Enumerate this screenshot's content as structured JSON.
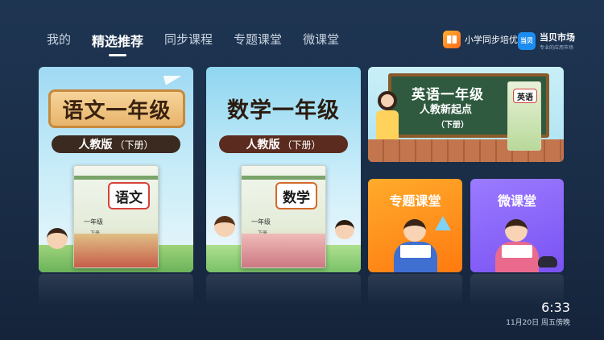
{
  "nav": {
    "items": [
      "我的",
      "精选推荐",
      "同步课程",
      "专题课堂",
      "微课堂"
    ],
    "active_index": 1
  },
  "brand_primary": {
    "label": "小学同步培优",
    "logo_text": "小学同步培优"
  },
  "brand_secondary": {
    "label": "当贝市场",
    "logo_text": "当贝",
    "sub": "专业的应用市场"
  },
  "cards": {
    "chinese": {
      "title": "语文一年级",
      "edition": "人教版",
      "volume": "（下册）",
      "book_badge": "语文",
      "book_grade": "一年级",
      "book_vol": "下册"
    },
    "math": {
      "title": "数学一年级",
      "edition": "人教版",
      "volume": "（下册）",
      "book_badge": "数学",
      "book_grade": "一年级",
      "book_vol": "下册"
    },
    "english": {
      "title": "英语一年级",
      "subtitle": "人教新起点",
      "volume": "（下册）",
      "book_badge": "英语"
    },
    "topic": {
      "label": "专题课堂"
    },
    "micro": {
      "label": "微课堂"
    }
  },
  "clock": {
    "time": "6:33",
    "date": "11月20日 周五傍晚"
  },
  "colors": {
    "background": "#1e3552",
    "topic_accent": "#ff8a1c",
    "micro_accent": "#8a64fa",
    "active_nav": "#ffffff"
  }
}
